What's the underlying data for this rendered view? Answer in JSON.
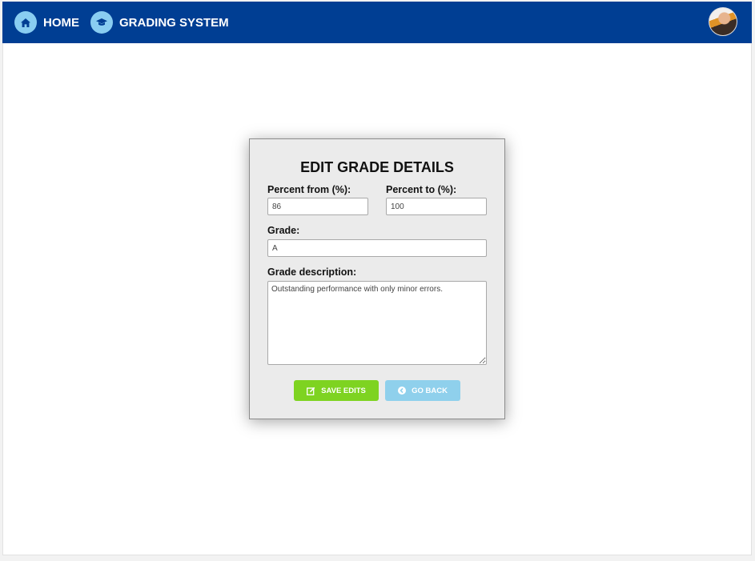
{
  "nav": {
    "home_label": "HOME",
    "home_icon": "home-icon",
    "grading_label": "GRADING SYSTEM",
    "grading_icon": "graduation-cap-icon",
    "avatar_icon": "user-avatar"
  },
  "form": {
    "title": "EDIT GRADE DETAILS",
    "percent_from_label": "Percent from (%):",
    "percent_from_value": "86",
    "percent_to_label": "Percent to (%):",
    "percent_to_value": "100",
    "grade_label": "Grade:",
    "grade_value": "A",
    "description_label": "Grade description:",
    "description_value": "Outstanding performance with only minor errors.",
    "save_label": "SAVE EDITS",
    "save_icon": "edit-icon",
    "back_label": "GO BACK",
    "back_icon": "chevron-left-circle-icon"
  },
  "colors": {
    "topbar": "#003e93",
    "nav_icon_bg": "#89cdf1",
    "save_button": "#7ed321",
    "back_button": "#8fd0ec",
    "card_bg": "#ebebeb"
  }
}
